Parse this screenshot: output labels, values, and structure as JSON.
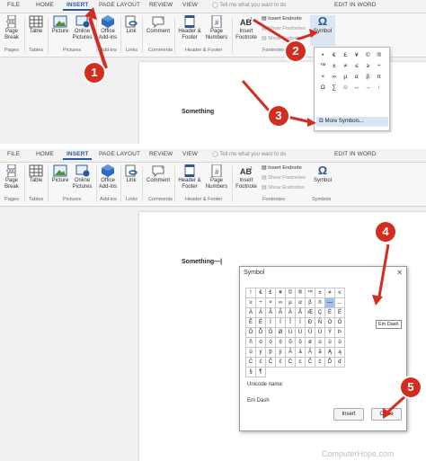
{
  "tabs": [
    "FILE",
    "HOME",
    "INSERT",
    "PAGE LAYOUT",
    "REVIEW",
    "VIEW"
  ],
  "tell_me": "Tell me what you want to do",
  "edit_in_word": "EDIT IN WORD",
  "ribbon": {
    "page_break": [
      "Page",
      "Break"
    ],
    "table": "Table",
    "picture": "Picture",
    "online_pictures": [
      "Online",
      "Pictures"
    ],
    "office_addins": [
      "Office",
      "Add-ins"
    ],
    "link": "Link",
    "comment": "Comment",
    "header_footer": [
      "Header &",
      "Footer"
    ],
    "page_numbers": [
      "Page",
      "Numbers"
    ],
    "insert_footnote": [
      "Insert",
      "Footnote"
    ],
    "insert_endnote": "Insert Endnote",
    "show_footnotes": "Show Footnotes",
    "show_endnotes": "Show Endnotes",
    "symbol": "Symbol",
    "groups": [
      "Pages",
      "Tables",
      "Pictures",
      "Add-ins",
      "Links",
      "Comments",
      "Header & Footer",
      "Footnotes",
      "Symbols"
    ]
  },
  "document_text_1": "Something",
  "document_text_2": "Something—|",
  "symbol_dropdown": {
    "symbols": [
      "•",
      "€",
      "£",
      "¥",
      "©",
      "®",
      "™",
      "±",
      "≠",
      "≤",
      "≥",
      "÷",
      "×",
      "∞",
      "µ",
      "α",
      "β",
      "π",
      "Ω",
      "∑",
      "☺",
      "↔",
      "→",
      "↑"
    ],
    "more_symbols": "More Symbols..."
  },
  "dialog": {
    "title": "Symbol",
    "close_x": "✕",
    "symbols": [
      "!",
      "€",
      "£",
      "¥",
      "©",
      "®",
      "™",
      "±",
      "≠",
      "≤",
      "≥",
      "÷",
      "×",
      "∞",
      "µ",
      "α",
      "β",
      "π",
      "—",
      "…",
      "À",
      "Á",
      "Â",
      "Ã",
      "Ä",
      "Å",
      "Æ",
      "Ç",
      "È",
      "É",
      "Ê",
      "Ë",
      "Ì",
      "Í",
      "Î",
      "Ï",
      "Ð",
      "Ñ",
      "Ò",
      "Ó",
      "Ô",
      "Õ",
      "Ö",
      "Ø",
      "Ù",
      "Ú",
      "Û",
      "Ü",
      "Ý",
      "Þ",
      "ñ",
      "ò",
      "ó",
      "ô",
      "õ",
      "ö",
      "ø",
      "ù",
      "ú",
      "û",
      "ü",
      "ý",
      "þ",
      "ÿ",
      "Ā",
      "ā",
      "Ă",
      "ă",
      "Ą",
      "ą",
      "Ć",
      "ć",
      "Ĉ",
      "ĉ",
      "Ċ",
      "ċ",
      "Č",
      "č",
      "Ď",
      "ď",
      "§",
      "¶"
    ],
    "selected_index": 18,
    "tooltip": "Em Dash",
    "unicode_label": "Unicode name:",
    "unicode_value": "Em Dash",
    "insert": "Insert",
    "close": "Close"
  },
  "steps": [
    "1",
    "2",
    "3",
    "4",
    "5"
  ],
  "watermark": "ComputerHope.com",
  "colors": {
    "accent": "#2b579a",
    "badge": "#d32d1f",
    "selected": "#9cc3ec"
  }
}
